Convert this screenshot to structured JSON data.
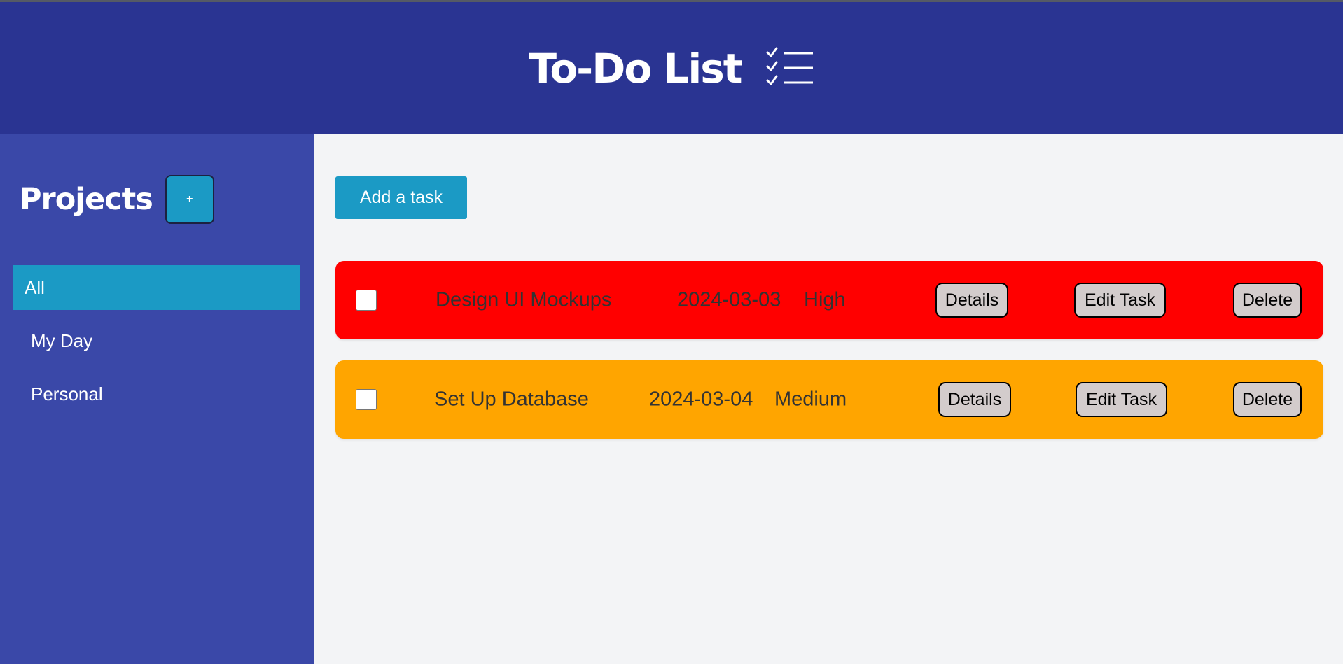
{
  "header": {
    "title": "To-Do List",
    "icon": "checklist-icon"
  },
  "sidebar": {
    "title": "Projects",
    "add_label": "+",
    "items": [
      {
        "label": "All",
        "active": true
      },
      {
        "label": "My Day",
        "active": false
      },
      {
        "label": "Personal",
        "active": false
      }
    ]
  },
  "main": {
    "add_task_label": "Add a task",
    "tasks": [
      {
        "title": "Design UI Mockups",
        "date": "2024-03-03",
        "priority": "High",
        "color": "#ff0000",
        "completed": false
      },
      {
        "title": "Set Up Database",
        "date": "2024-03-04",
        "priority": "Medium",
        "color": "#ffa500",
        "completed": false
      }
    ],
    "buttons": {
      "details": "Details",
      "edit": "Edit Task",
      "delete": "Delete"
    }
  },
  "colors": {
    "header_bg": "#2a3492",
    "sidebar_bg": "#3a48a8",
    "accent": "#1b9ac5",
    "content_bg": "#f3f4f6",
    "button_bg": "#d3cccc"
  }
}
